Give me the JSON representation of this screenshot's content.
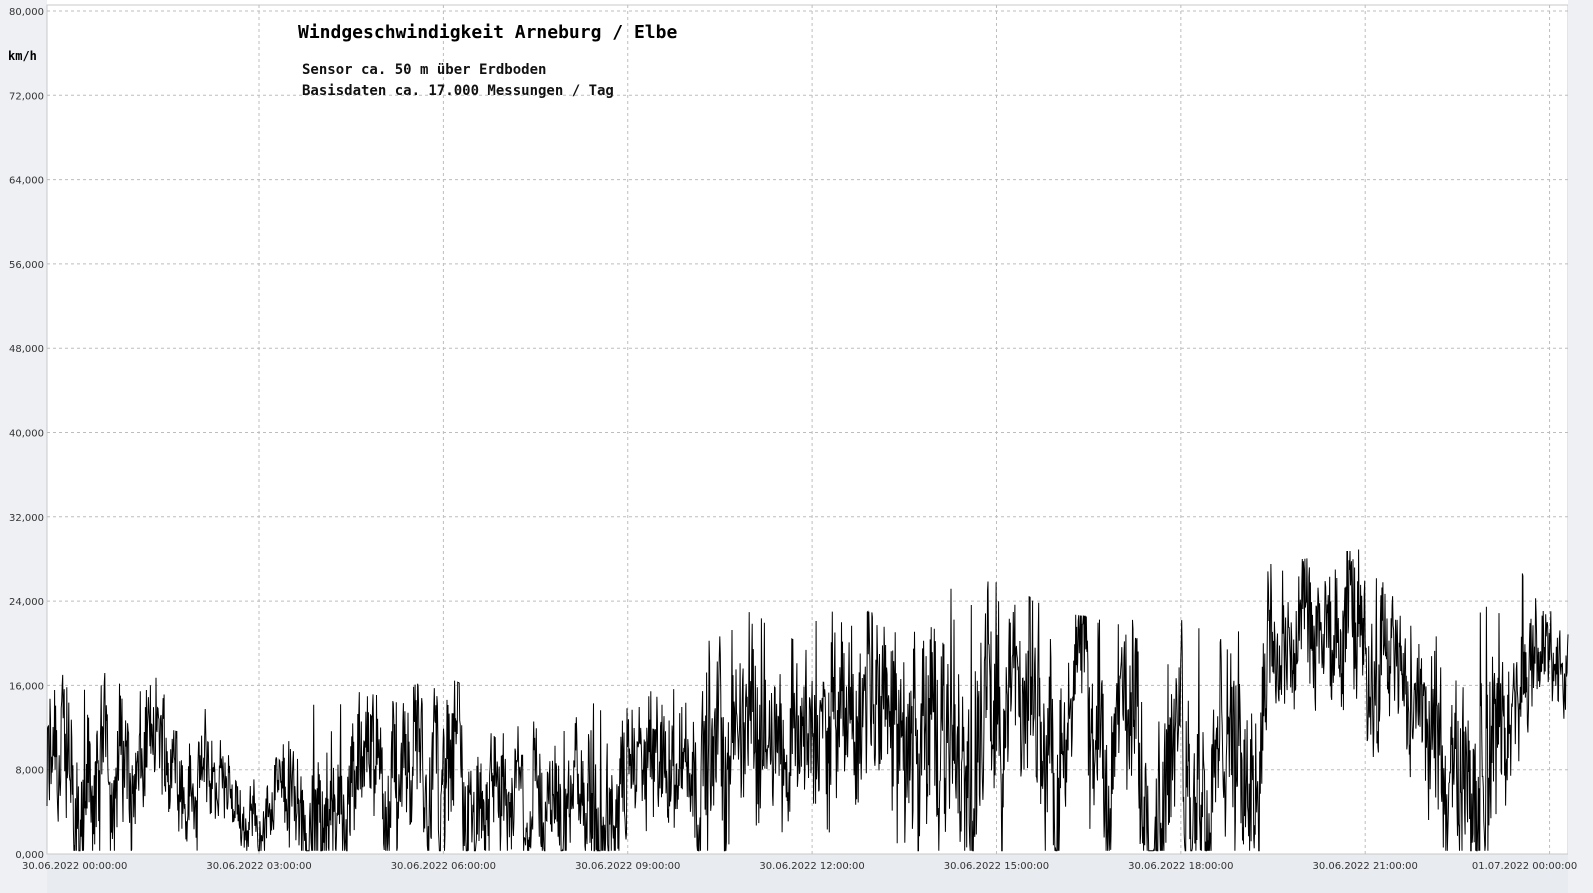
{
  "chart_data": {
    "type": "line",
    "title": "Windgeschwindigkeit  Arneburg / Elbe",
    "subtitle_lines": [
      "Sensor ca. 50 m über Erdboden",
      "Basisdaten ca. 17.000 Messungen / Tag"
    ],
    "ylabel": "km/h",
    "ylim": [
      0,
      80
    ],
    "yticks": [
      "0,000",
      "8,000",
      "16,000",
      "24,000",
      "32,000",
      "40,000",
      "48,000",
      "56,000",
      "64,000",
      "72,000",
      "80,000"
    ],
    "xlabels": [
      "30.06.2022  00:00:00",
      "30.06.2022  03:00:00",
      "30.06.2022  06:00:00",
      "30.06.2022  09:00:00",
      "30.06.2022  12:00:00",
      "30.06.2022  15:00:00",
      "30.06.2022  18:00:00",
      "30.06.2022  21:00:00",
      "01.07.2022  00:00:00"
    ],
    "x_range_hours": [
      -0.45,
      24.3
    ],
    "grid": true,
    "series_envelope": {
      "hours": [
        0,
        1,
        2,
        2.5,
        3,
        4,
        5,
        6,
        7,
        8,
        8.5,
        9,
        10,
        11,
        12,
        13,
        14,
        15,
        16,
        17,
        18,
        19,
        19.5,
        20,
        21,
        22,
        23,
        23.5,
        24
      ],
      "mean_kmh": [
        6,
        10,
        8,
        5,
        3,
        6,
        7,
        6,
        6,
        5,
        4,
        8,
        9,
        11,
        12,
        11,
        11,
        11,
        12,
        10,
        9,
        8,
        18,
        19,
        19,
        11,
        10,
        19,
        18
      ],
      "max_kmh": [
        17,
        18,
        15,
        10,
        7,
        16,
        15,
        17,
        14,
        12,
        15,
        15,
        21,
        23,
        23,
        23,
        25,
        26,
        23,
        22,
        23,
        21,
        28,
        28,
        29,
        20,
        25,
        27,
        24
      ]
    },
    "line_color": "#000000"
  }
}
